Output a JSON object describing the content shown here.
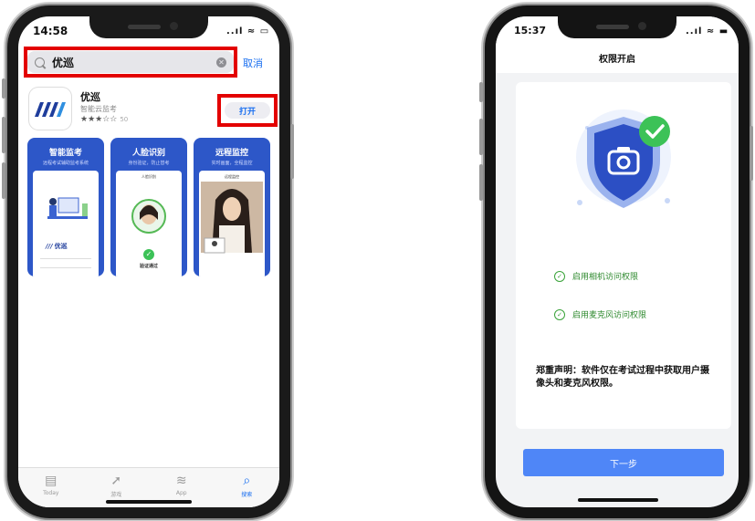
{
  "left_phone": {
    "status_time": "14:58",
    "status_icons": "..ıl ≈ ▭",
    "search": {
      "value": "优巡",
      "cancel_label": "取消"
    },
    "app": {
      "name": "优巡",
      "subtitle": "智能云监考",
      "rating_stars": "★★★☆☆",
      "rating_count": "50",
      "open_label": "打开"
    },
    "screenshots": [
      {
        "title": "智能监考",
        "subtitle": "远程考试辅助监考系统",
        "logo_text": "优巡"
      },
      {
        "title": "人脸识别",
        "subtitle": "身份验证，防止替考",
        "card_title": "人脸识别",
        "verify_label": "验证通过"
      },
      {
        "title": "远程监控",
        "subtitle": "实时画面，全程监控",
        "card_title": "远程监控"
      }
    ],
    "tabs": [
      {
        "label": "Today",
        "icon": "today-icon"
      },
      {
        "label": "游戏",
        "icon": "rocket-icon"
      },
      {
        "label": "App",
        "icon": "layers-icon"
      },
      {
        "label": "搜索",
        "icon": "search-icon"
      }
    ]
  },
  "right_phone": {
    "status_time": "15:37",
    "status_icons": "..ıl ≈ ▬",
    "title": "权限开启",
    "permissions": [
      {
        "label": "启用相机访问权限"
      },
      {
        "label": "启用麦克风访问权限"
      }
    ],
    "disclaimer": "郑重声明：软件仅在考试过程中获取用户摄像头和麦克风权限。",
    "next_label": "下一步"
  },
  "colors": {
    "accent": "#1a6ff0",
    "highlight": "#e30000",
    "shield": "#2c4fc4",
    "check_green": "#3cc257",
    "next_button": "#4f86f7"
  }
}
